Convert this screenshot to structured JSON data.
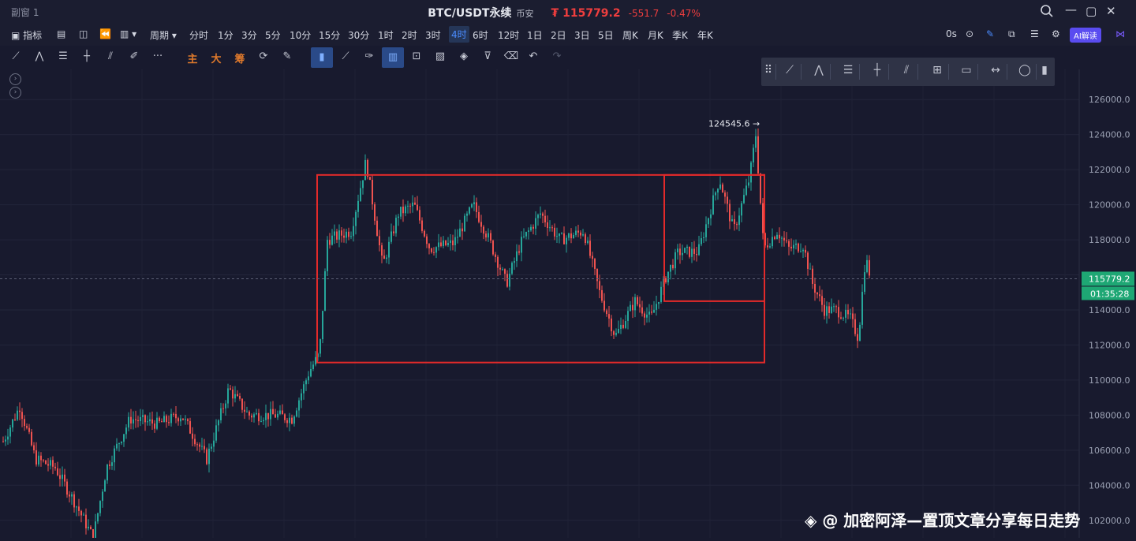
{
  "window": {
    "title": "副窗 1"
  },
  "header": {
    "symbol": "BTC/USDT永续",
    "exchange": "币安",
    "price": "₮ 115779.2",
    "change": "-551.7",
    "change_pct": "-0.47%"
  },
  "toolbar": {
    "indicator_label": "指标",
    "period_label": "周期",
    "intervals": [
      "分时",
      "1分",
      "3分",
      "5分",
      "10分",
      "15分",
      "30分",
      "1时",
      "2时",
      "3时",
      "4时",
      "6时",
      "12时",
      "1日",
      "2日",
      "3日",
      "5日",
      "周K",
      "月K",
      "季K",
      "年K"
    ],
    "active_interval": "4时",
    "countdown": "0s",
    "ai_label": "AI解读"
  },
  "drawing_toolbar": {
    "main_label": "主",
    "big_label": "大",
    "chip_label": "筹"
  },
  "chart_data": {
    "type": "candlestick",
    "y_ticks": [
      "126000.0",
      "124000.0",
      "122000.0",
      "120000.0",
      "118000.0",
      "116000.0",
      "114000.0",
      "112000.0",
      "110000.0",
      "108000.0",
      "106000.0",
      "104000.0",
      "102000.0"
    ],
    "ylim": [
      101000,
      127000
    ],
    "last_price_label": "115779.2",
    "countdown_label": "01:35:28",
    "high_label": "124545.6 →",
    "last_price": 115779.2,
    "rects": [
      {
        "low": 111000,
        "high": 121700
      },
      {
        "low": 114500,
        "high": 121700
      }
    ],
    "up_color": "#26a69a",
    "down_color": "#ef5350"
  },
  "watermark": "@ 加密阿泽—置顶文章分享每日走势"
}
